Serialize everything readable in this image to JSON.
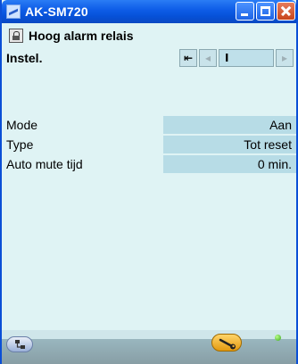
{
  "window": {
    "title": "AK-SM720"
  },
  "header": {
    "title": "Hoog alarm relais",
    "subtitle": "Instel."
  },
  "nav": {
    "first": "⇤",
    "prev": "◂",
    "page": "I",
    "next": "▸"
  },
  "rows": [
    {
      "label": "Mode",
      "value": "Aan"
    },
    {
      "label": "Type",
      "value": "Tot reset"
    },
    {
      "label": "Auto mute tijd",
      "value": "0 min."
    }
  ],
  "icons": {
    "app": "chart-app-icon",
    "lock": "lock-icon",
    "left_action": "network-tree-icon",
    "right_action": "wrench-icon",
    "status": "status-led-icon"
  },
  "colors": {
    "titlebar": "#0651d8",
    "background": "#dff3f4",
    "value_cell": "#b7dce6",
    "status_led": "#3aa51b"
  }
}
